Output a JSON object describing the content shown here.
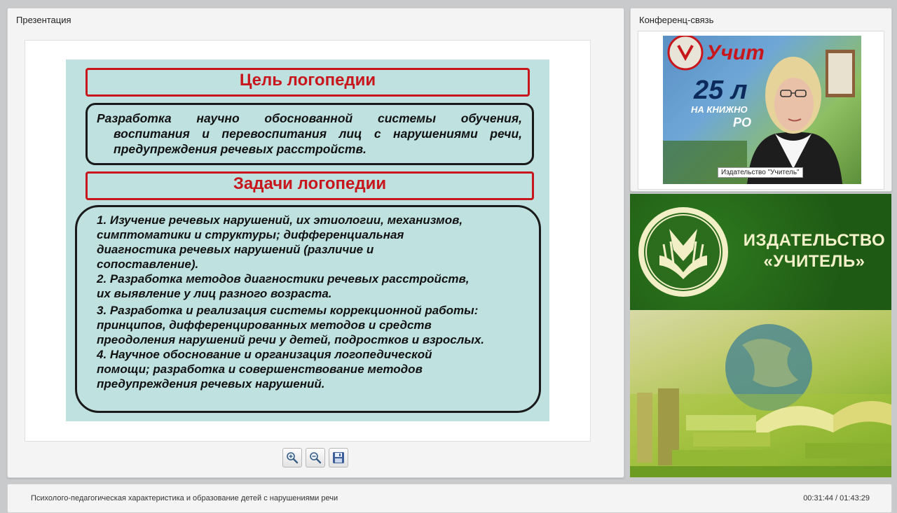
{
  "presentation": {
    "panel_title": "Презентация",
    "slide": {
      "goal_title": "Цель логопедии",
      "goal_lines": [
        "Разработка научно обоснованной системы обучения,",
        "воспитания и перевоспитания лиц с нарушениями речи,",
        "предупреждения речевых расстройств."
      ],
      "tasks_title": "Задачи логопедии",
      "tasks_lines": [
        "1. Изучение речевых нарушений, их этиологии, механизмов,",
        "симптоматики и структуры; дифференциальная",
        "диагностика речевых нарушений (различие и",
        "сопоставление).",
        "2. Разработка методов  диагностики речевых расстройств,",
        "их выявление у лиц разного возраста.",
        "3. Разработка и реализация системы коррекционной работы:",
        "принципов, дифференцированных методов и средств",
        "преодоления нарушений речи у детей, подростков и взрослых.",
        "4. Научное обоснование и организация  логопедической",
        "помощи; разработка и совершенствование методов",
        "предупреждения речевых нарушений."
      ],
      "title_color": "#c8161d"
    },
    "toolbar": {
      "zoom_in_icon": "zoom-in-icon",
      "zoom_out_icon": "zoom-out-icon",
      "save_icon": "floppy-disk-icon"
    }
  },
  "conference": {
    "panel_title": "Конференц-связь",
    "video_caption": "Издательство \"Учитель\"",
    "background_poster": {
      "brand": "Учит",
      "big_text": "25 л",
      "line1": "НА КНИЖНО",
      "line2": "РО"
    }
  },
  "publisher_banner": {
    "name_line1": "ИЗДАТЕЛЬСТВО",
    "name_line2": "«УЧИТЕЛЬ»",
    "logo_icon": "publisher-book-logo-icon",
    "brand_color": "#1f5a14"
  },
  "footer": {
    "lecture_title": "Психолого-педагогическая характеристика и образование детей с нарушениями речи",
    "time": "00:31:44 / 01:43:29"
  }
}
